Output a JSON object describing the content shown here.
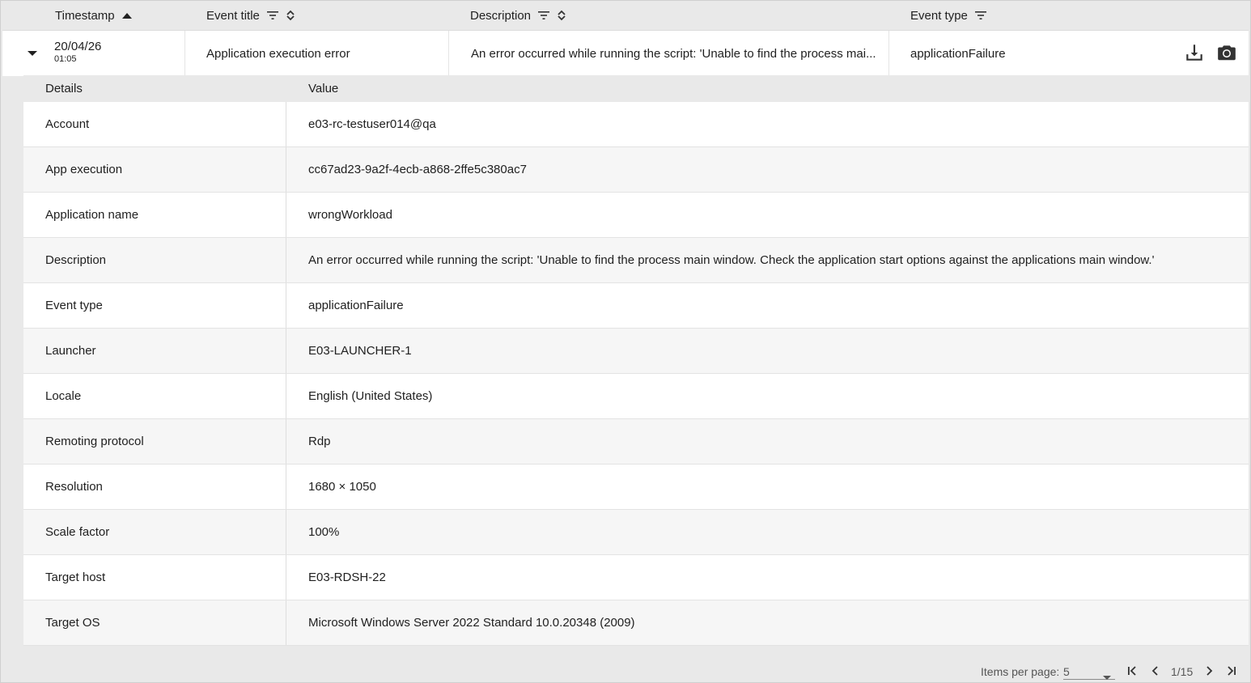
{
  "columns": {
    "timestamp": "Timestamp",
    "event_title": "Event title",
    "description": "Description",
    "event_type": "Event type"
  },
  "event": {
    "date": "20/04/26",
    "time": "01:05",
    "title": "Application execution error",
    "description": "An error occurred while running the script: 'Unable to find the process mai...",
    "type": "applicationFailure"
  },
  "details_header": {
    "key": "Details",
    "value": "Value"
  },
  "details": [
    {
      "key": "Account",
      "value": "e03-rc-testuser014@qa"
    },
    {
      "key": "App execution",
      "value": "cc67ad23-9a2f-4ecb-a868-2ffe5c380ac7"
    },
    {
      "key": "Application name",
      "value": "wrongWorkload"
    },
    {
      "key": "Description",
      "value": "An error occurred while running the script: 'Unable to find the process main window. Check the application start options against the applications main window.'"
    },
    {
      "key": "Event type",
      "value": "applicationFailure"
    },
    {
      "key": "Launcher",
      "value": "E03-LAUNCHER-1"
    },
    {
      "key": "Locale",
      "value": "English (United States)"
    },
    {
      "key": "Remoting protocol",
      "value": "Rdp"
    },
    {
      "key": "Resolution",
      "value": "1680 × 1050"
    },
    {
      "key": "Scale factor",
      "value": "100%"
    },
    {
      "key": "Target host",
      "value": "E03-RDSH-22"
    },
    {
      "key": "Target OS",
      "value": "Microsoft Windows Server 2022 Standard 10.0.20348 (2009)"
    }
  ],
  "paginator": {
    "items_per_page_label": "Items per page:",
    "items_per_page_value": "5",
    "range": "1/15"
  },
  "icons": {
    "sort_asc": "arrow-up-icon",
    "filter": "filter-icon",
    "sort": "sort-icon",
    "expand": "caret-down-icon",
    "download": "download-icon",
    "screenshot": "camera-icon",
    "first_page": "first-page-icon",
    "prev_page": "chevron-left-icon",
    "next_page": "chevron-right-icon",
    "last_page": "last-page-icon"
  }
}
